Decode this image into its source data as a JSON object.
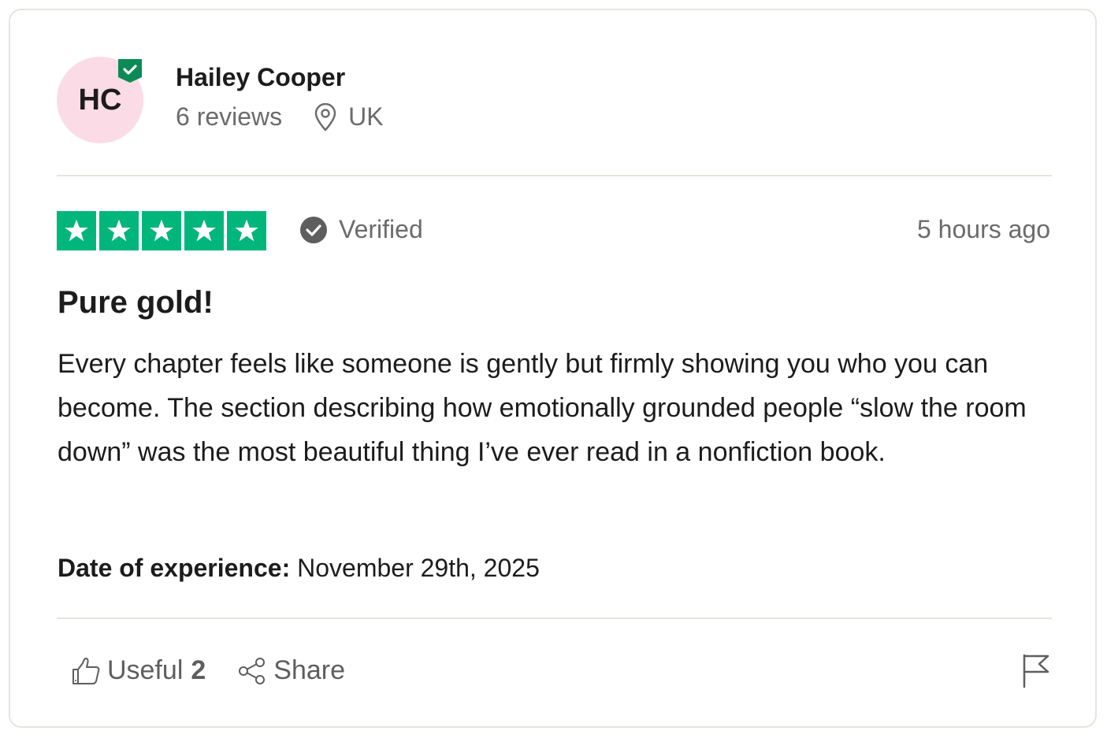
{
  "reviewer": {
    "initials": "HC",
    "name": "Hailey Cooper",
    "reviews_count": "6 reviews",
    "location": "UK",
    "avatar_color": "#fbdce6",
    "badge_color": "#0b8a55"
  },
  "review": {
    "rating": 5,
    "max_rating": 5,
    "star_color": "#00b67a",
    "verified_label": "Verified",
    "time_ago": "5 hours ago",
    "title": "Pure gold!",
    "body": "Every chapter feels like someone is gently but firmly showing you who you can become. The section describing how emotionally grounded people “slow the room down” was the most beautiful thing I’ve ever read in a nonfiction book.",
    "date_label": "Date of experience:",
    "date_value": "November 29th, 2025"
  },
  "actions": {
    "useful_label": "Useful",
    "useful_count": "2",
    "share_label": "Share",
    "icons": [
      "thumbs-up-icon",
      "share-icon",
      "flag-icon"
    ]
  }
}
